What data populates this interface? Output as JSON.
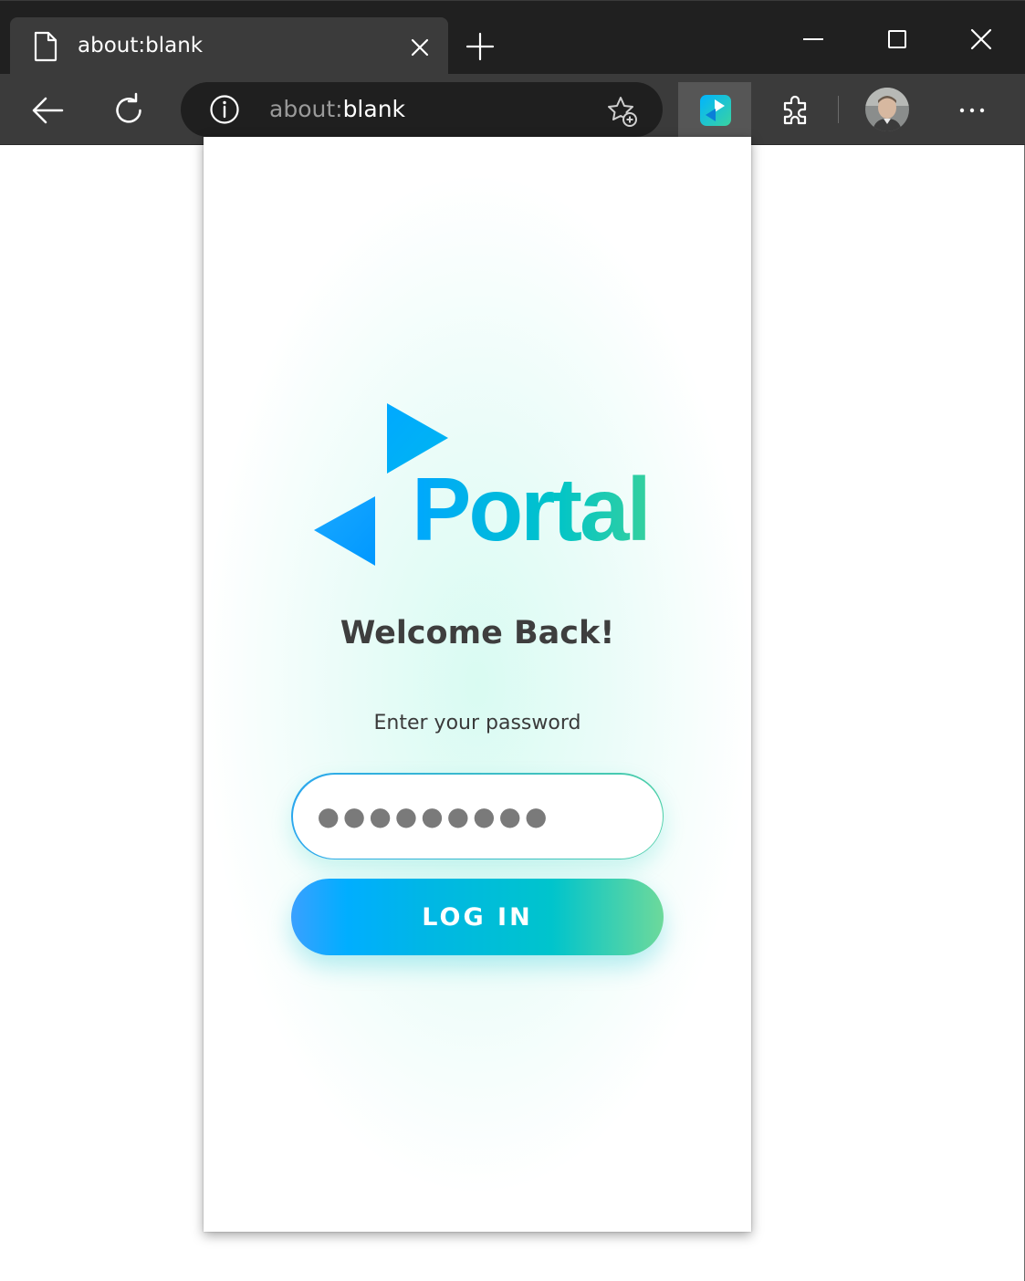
{
  "browser": {
    "tab": {
      "title": "about:blank"
    },
    "address_bar": {
      "scheme": "about:",
      "rest": "blank"
    },
    "window_controls": [
      "minimize-icon",
      "maximize-icon",
      "close-icon"
    ],
    "toolbar_icons": [
      "back-arrow-icon",
      "refresh-icon",
      "site-info-icon",
      "add-favorite-icon",
      "portal-extension-icon",
      "extensions-puzzle-icon",
      "profile-avatar",
      "more-menu-icon"
    ]
  },
  "popup": {
    "logo_text": "Portal",
    "welcome": "Welcome Back!",
    "prompt": "Enter your password",
    "password_value": "●●●●●●●●●",
    "login_label": "LOG IN"
  },
  "colors": {
    "titlebar": "#202020",
    "toolbar": "#3b3b3b",
    "accent_blue": "#00a7ff",
    "accent_teal": "#00c4c9",
    "accent_green": "#35d09e",
    "text_dark": "#3e3e3e"
  }
}
